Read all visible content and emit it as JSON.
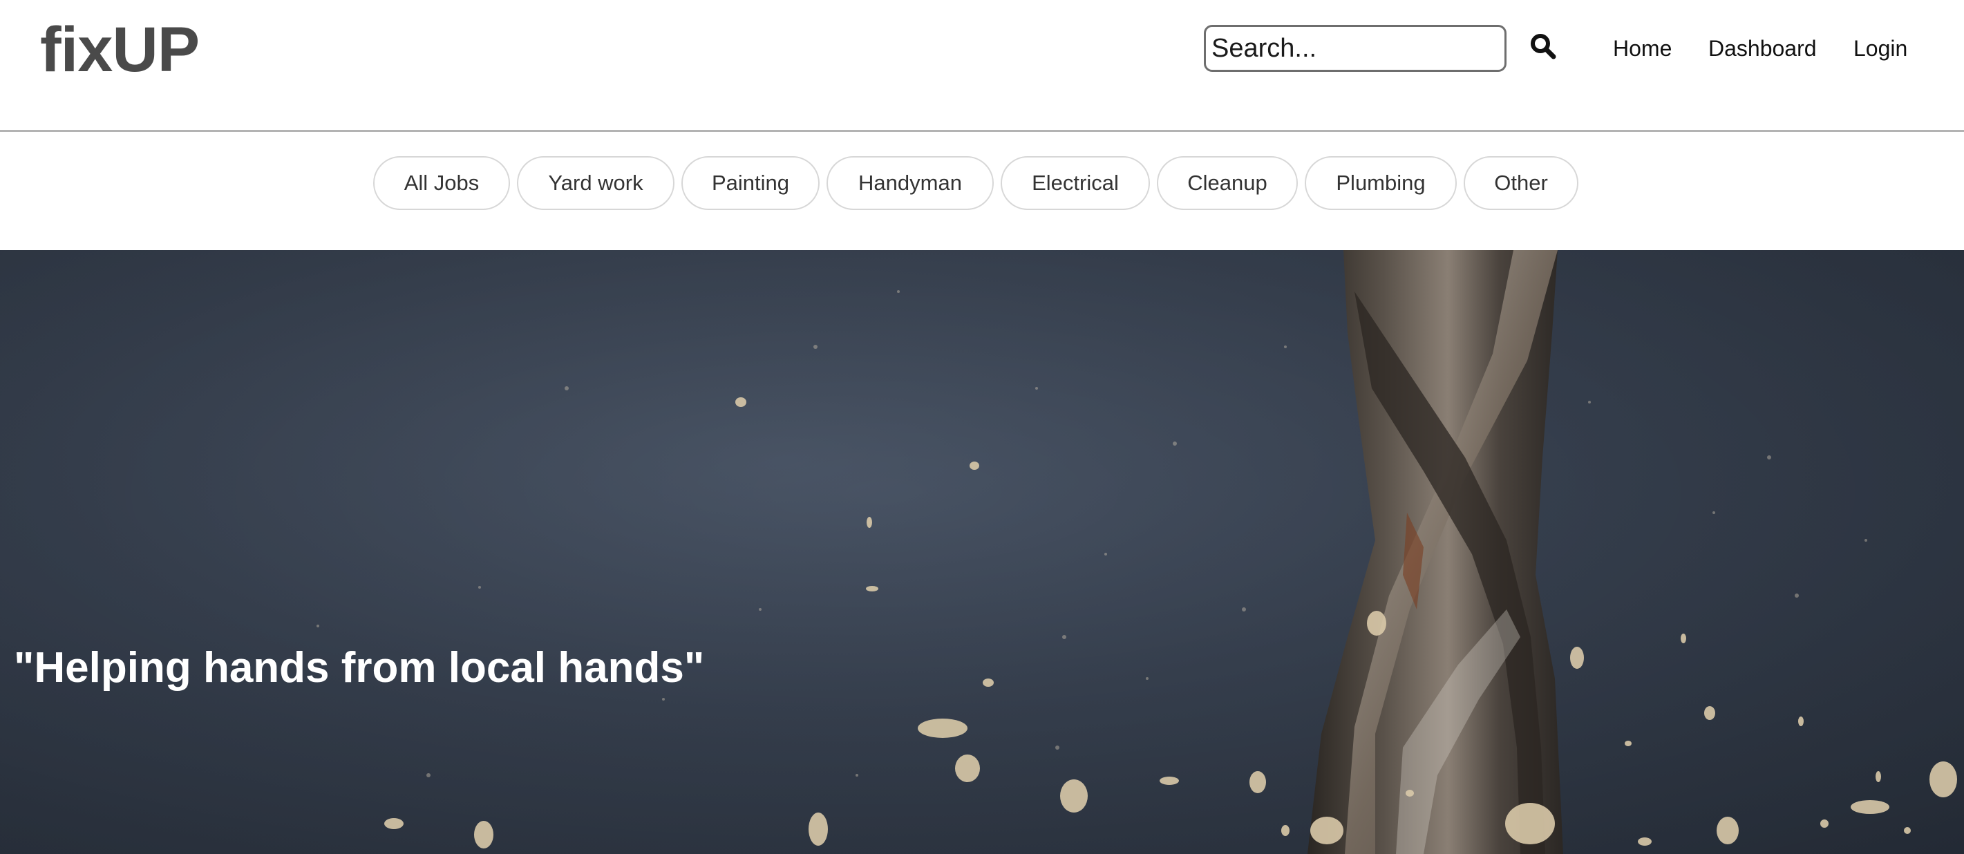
{
  "header": {
    "logo": "fixUP",
    "search": {
      "placeholder": "Search...",
      "value": ""
    },
    "search_icon": "search-icon",
    "nav": [
      {
        "label": "Home"
      },
      {
        "label": "Dashboard"
      },
      {
        "label": "Login"
      }
    ]
  },
  "categories": [
    {
      "label": "All Jobs"
    },
    {
      "label": "Yard work"
    },
    {
      "label": "Painting"
    },
    {
      "label": "Handyman"
    },
    {
      "label": "Electrical"
    },
    {
      "label": "Cleanup"
    },
    {
      "label": "Plumbing"
    },
    {
      "label": "Other"
    }
  ],
  "hero": {
    "tagline": "\"Helping hands from local hands\"",
    "image": "drill-bit-photo"
  },
  "colors": {
    "logo": "#4a4a4a",
    "hero_background": "#3b4555",
    "pill_border": "#d7d7d7",
    "header_border": "#b3b3b3"
  }
}
